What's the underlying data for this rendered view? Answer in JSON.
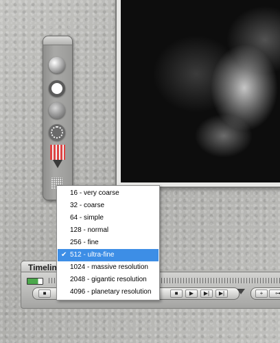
{
  "timeline": {
    "title": "Timeline"
  },
  "render_toolbar": {
    "icons": [
      "sphere-render-icon",
      "white-dot-icon",
      "shaded-sphere-icon",
      "dotted-ring-icon",
      "level-meter-icon",
      "grid-icon"
    ]
  },
  "menu": {
    "items": [
      {
        "label": "16 - very coarse",
        "checked": false
      },
      {
        "label": "32 - coarse",
        "checked": false
      },
      {
        "label": "64 - simple",
        "checked": false
      },
      {
        "label": "128 - normal",
        "checked": false
      },
      {
        "label": "256 - fine",
        "checked": false
      },
      {
        "label": "512 - ultra-fine",
        "checked": true
      },
      {
        "label": "1024 - massive resolution",
        "checked": false
      },
      {
        "label": "2048 - gigantic resolution",
        "checked": false
      },
      {
        "label": "4096 - planetary resolution",
        "checked": false
      }
    ],
    "check_glyph": "✔",
    "highlight_color": "#3d8ee6"
  }
}
